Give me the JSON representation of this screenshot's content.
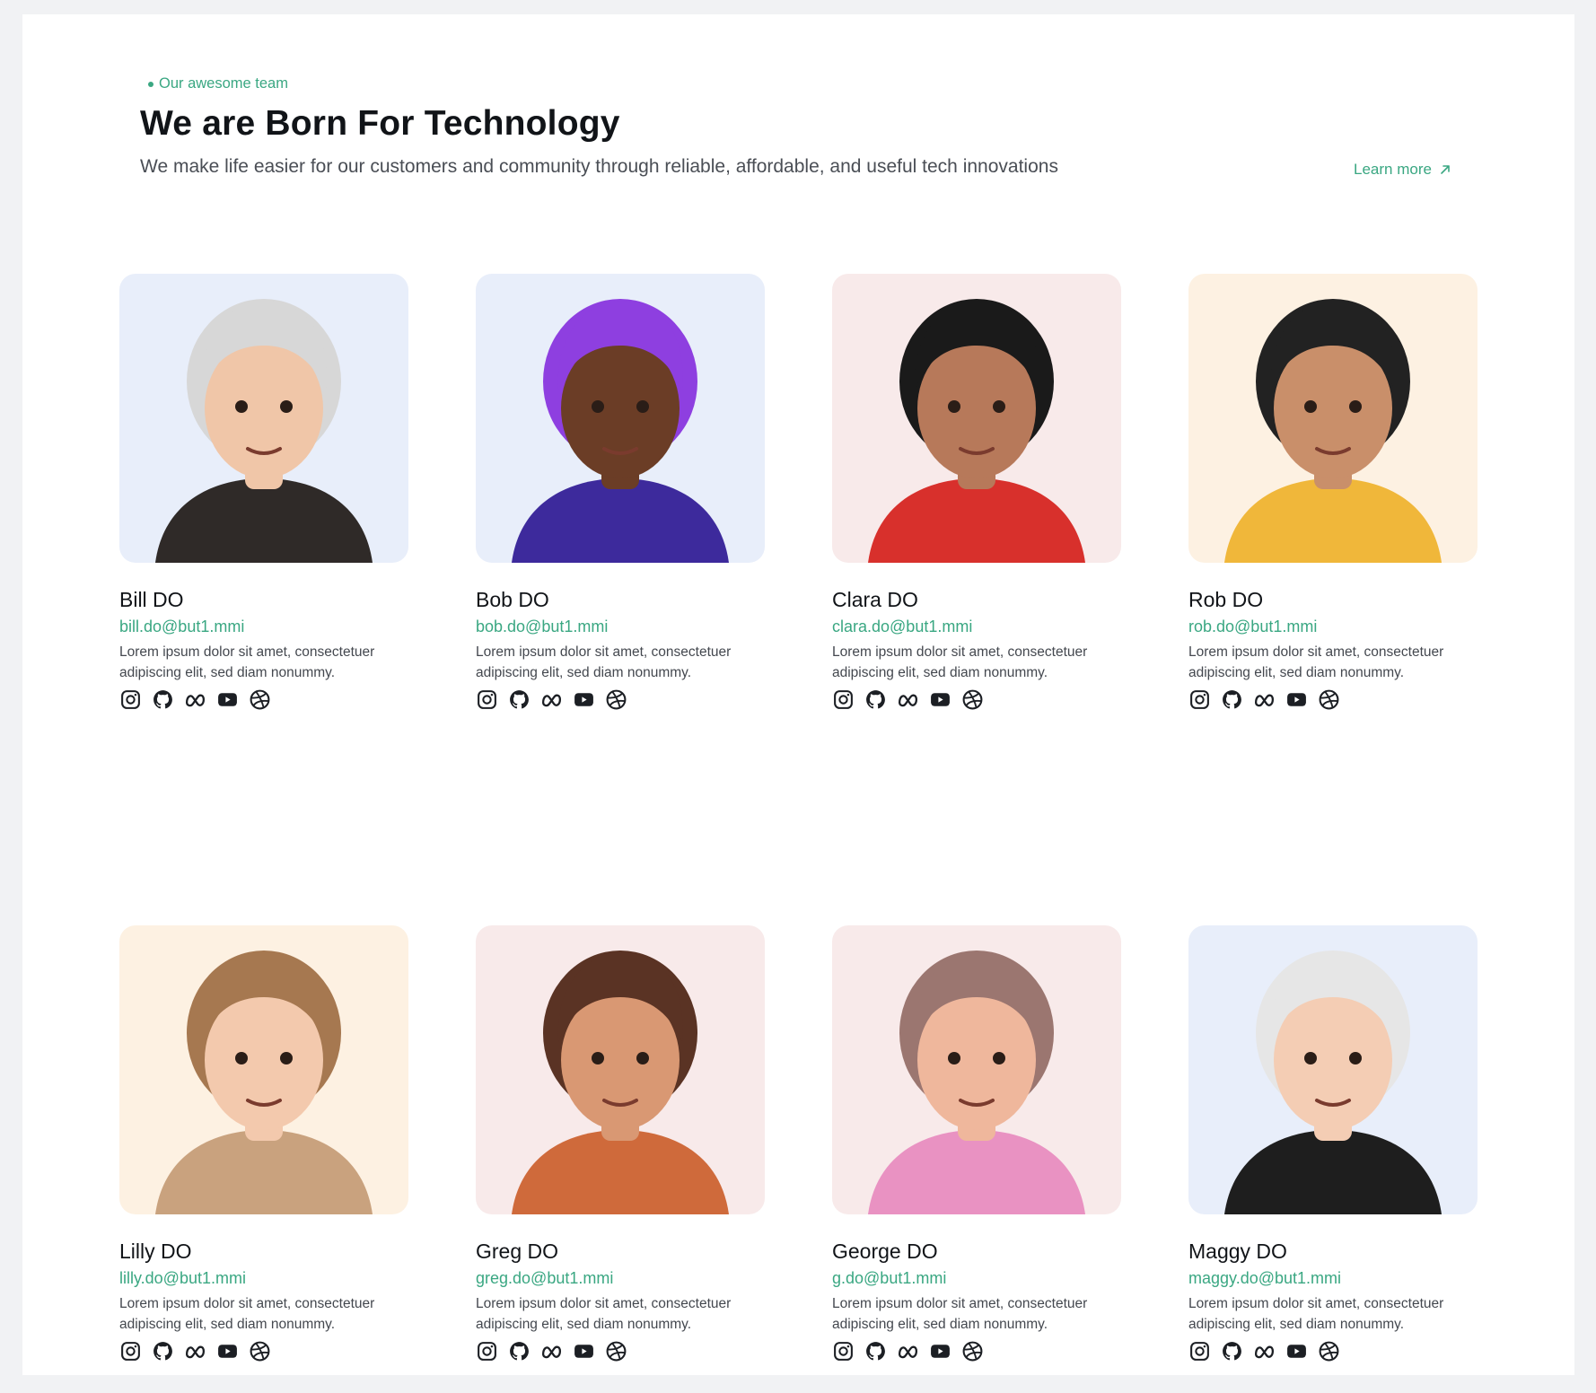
{
  "header": {
    "eyebrow": "Our awesome team",
    "title": "We are Born For Technology",
    "subtitle": "We make life easier for our customers and community through reliable, affordable, and useful tech innovations",
    "learn_more": "Learn more"
  },
  "colors": {
    "accent": "#3aa782",
    "blue_bg": "#e8eefa",
    "pink_bg": "#f8eaea",
    "cream_bg": "#fdf1e2"
  },
  "team": [
    {
      "name": "Bill DO",
      "email": "bill.do@but1.mmi",
      "bio": "Lorem ipsum dolor sit amet, consectetuer adipiscing elit, sed diam nonummy.",
      "bg": "#e8eefa",
      "hair": "#d7d7d7",
      "skin": "#f0c6a8",
      "shirt": "#2f2a28"
    },
    {
      "name": "Bob DO",
      "email": "bob.do@but1.mmi",
      "bio": "Lorem ipsum dolor sit amet, consectetuer adipiscing elit, sed diam nonummy.",
      "bg": "#e8eefa",
      "hair": "#8e3fe0",
      "skin": "#6b3d26",
      "shirt": "#3d2a9c"
    },
    {
      "name": "Clara DO",
      "email": "clara.do@but1.mmi",
      "bio": "Lorem ipsum dolor sit amet, consectetuer adipiscing elit, sed diam nonummy.",
      "bg": "#f8eaea",
      "hair": "#1a1a1a",
      "skin": "#b7795a",
      "shirt": "#d8302c"
    },
    {
      "name": "Rob DO",
      "email": "rob.do@but1.mmi",
      "bio": "Lorem ipsum dolor sit amet, consectetuer adipiscing elit, sed diam nonummy.",
      "bg": "#fdf1e2",
      "hair": "#222222",
      "skin": "#c98f6a",
      "shirt": "#f0b73a"
    },
    {
      "name": "Lilly DO",
      "email": "lilly.do@but1.mmi",
      "bio": "Lorem ipsum dolor sit amet, consectetuer adipiscing elit, sed diam nonummy.",
      "bg": "#fdf1e2",
      "hair": "#a67850",
      "skin": "#f3c9ad",
      "shirt": "#c9a27e"
    },
    {
      "name": "Greg DO",
      "email": "greg.do@but1.mmi",
      "bio": "Lorem ipsum dolor sit amet, consectetuer adipiscing elit, sed diam nonummy.",
      "bg": "#f8eaea",
      "hair": "#5a3324",
      "skin": "#d99873",
      "shirt": "#cf6a3b"
    },
    {
      "name": "George DO",
      "email": "g.do@but1.mmi",
      "bio": "Lorem ipsum dolor sit amet, consectetuer adipiscing elit, sed diam nonummy.",
      "bg": "#f8eaea",
      "hair": "#9b7670",
      "skin": "#efb79c",
      "shirt": "#e992c2"
    },
    {
      "name": "Maggy DO",
      "email": "maggy.do@but1.mmi",
      "bio": "Lorem ipsum dolor sit amet, consectetuer adipiscing elit, sed diam nonummy.",
      "bg": "#e8eefa",
      "hair": "#e6e6e6",
      "skin": "#f4cdb4",
      "shirt": "#1e1e1e"
    }
  ],
  "social_icons": [
    "instagram-icon",
    "github-icon",
    "meta-icon",
    "youtube-icon",
    "dribbble-icon"
  ]
}
